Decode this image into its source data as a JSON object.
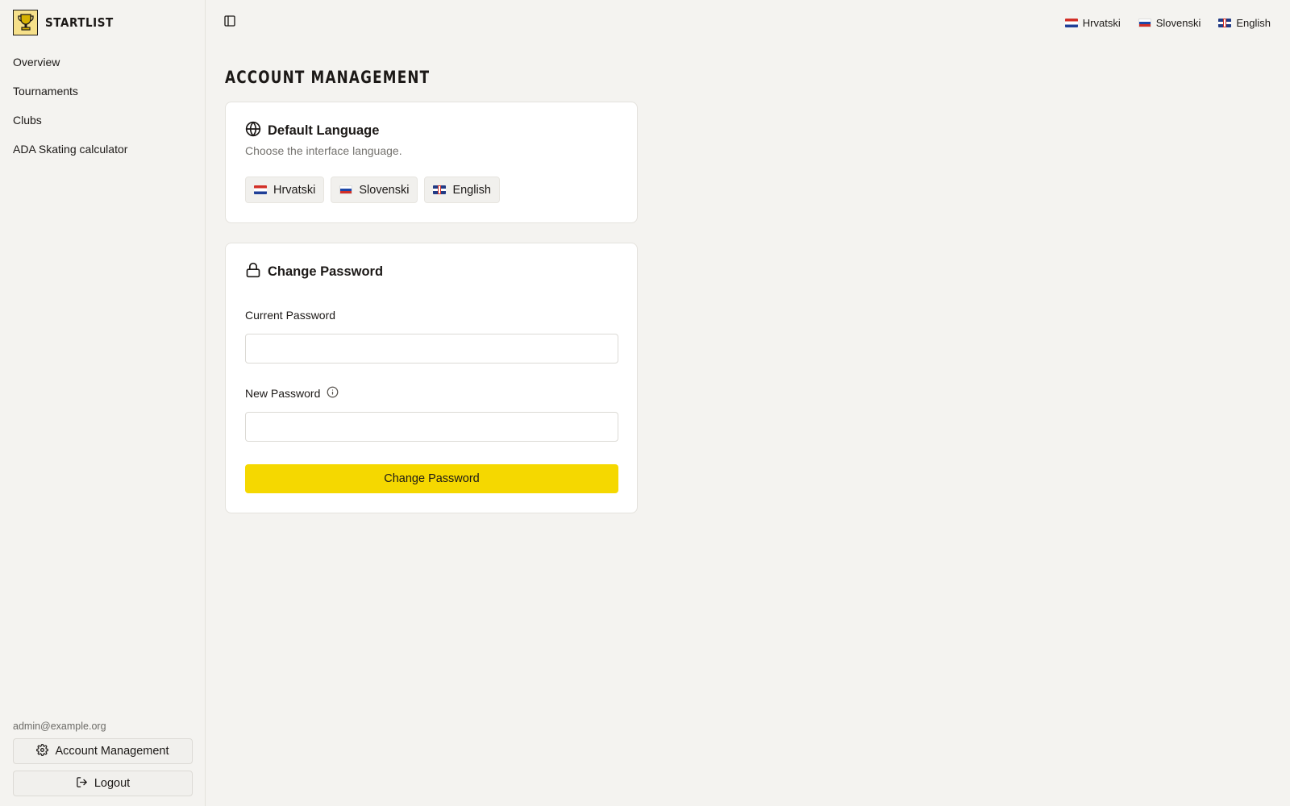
{
  "brand": {
    "name": "STARTLIST",
    "accent_color": "#f5d800"
  },
  "sidebar": {
    "nav": [
      {
        "label": "Overview"
      },
      {
        "label": "Tournaments"
      },
      {
        "label": "Clubs"
      },
      {
        "label": "ADA Skating calculator"
      }
    ],
    "user_email": "admin@example.org",
    "account_button": {
      "label": "Account Management",
      "icon": "gear-icon"
    },
    "logout_button": {
      "label": "Logout",
      "icon": "logout-icon"
    }
  },
  "topbar": {
    "languages": [
      {
        "label": "Hrvatski",
        "flag": "hr"
      },
      {
        "label": "Slovenski",
        "flag": "si"
      },
      {
        "label": "English",
        "flag": "gb"
      }
    ]
  },
  "page": {
    "title": "ACCOUNT MANAGEMENT"
  },
  "language_card": {
    "title": "Default Language",
    "description": "Choose the interface language.",
    "options": [
      {
        "label": "Hrvatski",
        "flag": "hr"
      },
      {
        "label": "Slovenski",
        "flag": "si"
      },
      {
        "label": "English",
        "flag": "gb"
      }
    ]
  },
  "password_card": {
    "title": "Change Password",
    "current_label": "Current Password",
    "current_value": "",
    "new_label": "New Password",
    "new_value": "",
    "submit_label": "Change Password"
  }
}
